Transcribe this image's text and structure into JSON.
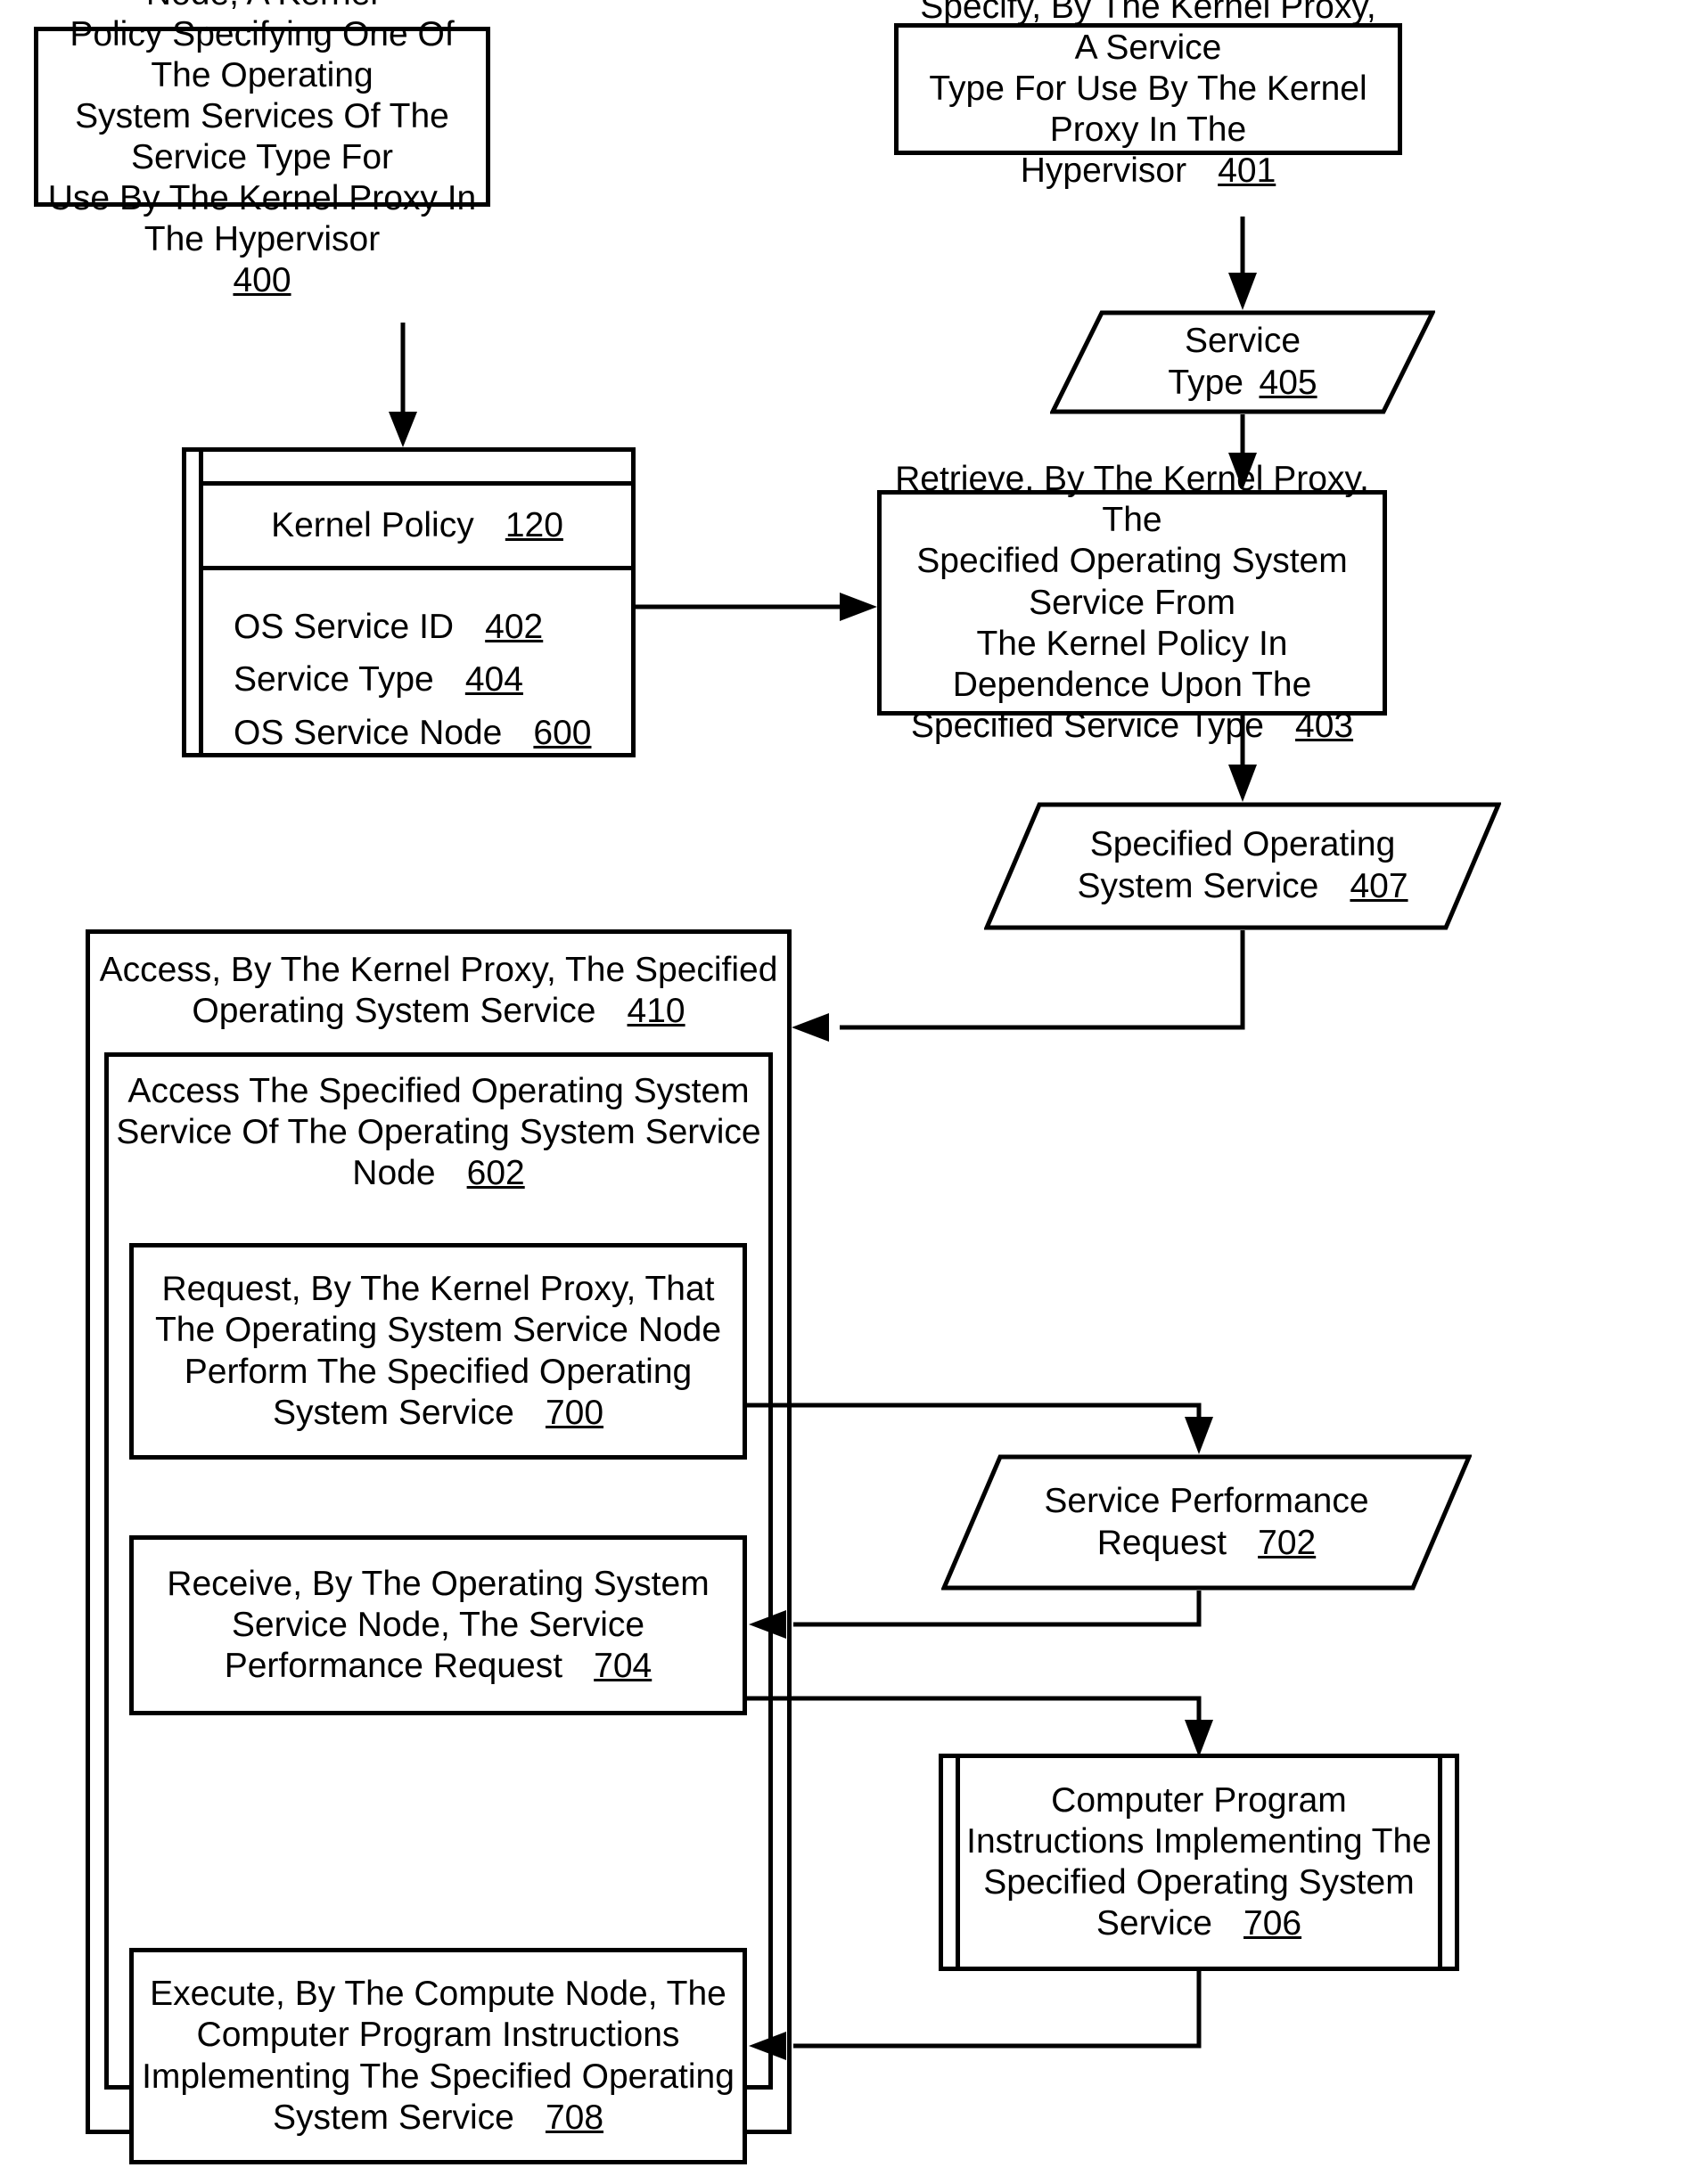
{
  "figure": {
    "type": "patent-flowchart",
    "orientation": "portrait"
  },
  "nodes": {
    "n400": {
      "id": "400",
      "shape": "process",
      "lines": [
        "Establish, On The Compute Node, A Kernel",
        "Policy Specifying One Of The Operating",
        "System Services Of The Service Type For",
        "Use By The Kernel Proxy In The Hypervisor"
      ],
      "ref": "400"
    },
    "n401": {
      "id": "401",
      "shape": "process",
      "lines": [
        "Specify, By The Kernel Proxy, A Service",
        "Type For Use By The Kernel Proxy In The",
        "Hypervisor"
      ],
      "ref": "401"
    },
    "n405": {
      "id": "405",
      "shape": "data-parallelogram",
      "lines": [
        "Service",
        "Type"
      ],
      "ref": "405"
    },
    "n120": {
      "id": "120",
      "shape": "document-stack",
      "title": "Kernel Policy",
      "ref": "120",
      "fields": [
        {
          "label": "OS Service ID",
          "ref": "402"
        },
        {
          "label": "Service Type",
          "ref": "404"
        },
        {
          "label": "OS Service Node",
          "ref": "600"
        }
      ]
    },
    "n403": {
      "id": "403",
      "shape": "process",
      "lines": [
        "Retrieve, By The Kernel Proxy, The",
        "Specified Operating System Service From",
        "The Kernel Policy In Dependence Upon The",
        "Specified Service Type"
      ],
      "ref": "403"
    },
    "n407": {
      "id": "407",
      "shape": "data-parallelogram",
      "lines": [
        "Specified Operating",
        "System Service"
      ],
      "ref": "407"
    },
    "n410": {
      "id": "410",
      "shape": "container",
      "lines": [
        "Access, By The Kernel Proxy, The Specified",
        "Operating System Service"
      ],
      "ref": "410"
    },
    "n602": {
      "id": "602",
      "shape": "container",
      "lines": [
        "Access The Specified Operating System",
        "Service Of The Operating System Service",
        "Node"
      ],
      "ref": "602"
    },
    "n700": {
      "id": "700",
      "shape": "process",
      "lines": [
        "Request, By The Kernel Proxy, That",
        "The Operating System Service Node",
        "Perform The Specified Operating",
        "System Service"
      ],
      "ref": "700"
    },
    "n702": {
      "id": "702",
      "shape": "data-parallelogram",
      "lines": [
        "Service Performance",
        "Request"
      ],
      "ref": "702"
    },
    "n704": {
      "id": "704",
      "shape": "process",
      "lines": [
        "Receive, By The Operating System",
        "Service Node, The Service",
        "Performance Request"
      ],
      "ref": "704"
    },
    "n706": {
      "id": "706",
      "shape": "document-stack",
      "lines": [
        "Computer Program",
        "Instructions Implementing The",
        "Specified Operating System",
        "Service"
      ],
      "ref": "706"
    },
    "n708": {
      "id": "708",
      "shape": "process",
      "lines": [
        "Execute, By The Compute Node, The",
        "Computer Program Instructions",
        "Implementing The Specified Operating",
        "System Service"
      ],
      "ref": "708"
    }
  },
  "edges": [
    {
      "from": "400",
      "to": "120",
      "style": "arrow"
    },
    {
      "from": "401",
      "to": "405",
      "style": "arrow"
    },
    {
      "from": "405",
      "to": "403",
      "style": "arrow"
    },
    {
      "from": "120",
      "to": "403",
      "style": "arrow"
    },
    {
      "from": "403",
      "to": "407",
      "style": "arrow"
    },
    {
      "from": "407",
      "to": "410",
      "style": "arrow"
    },
    {
      "from": "700",
      "to": "702",
      "style": "arrow"
    },
    {
      "from": "702",
      "to": "704",
      "style": "arrow"
    },
    {
      "from": "704",
      "to": "706",
      "style": "arrow"
    },
    {
      "from": "706",
      "to": "708",
      "style": "arrow"
    }
  ],
  "colors": {
    "line": "#000000",
    "fill": "#ffffff"
  }
}
